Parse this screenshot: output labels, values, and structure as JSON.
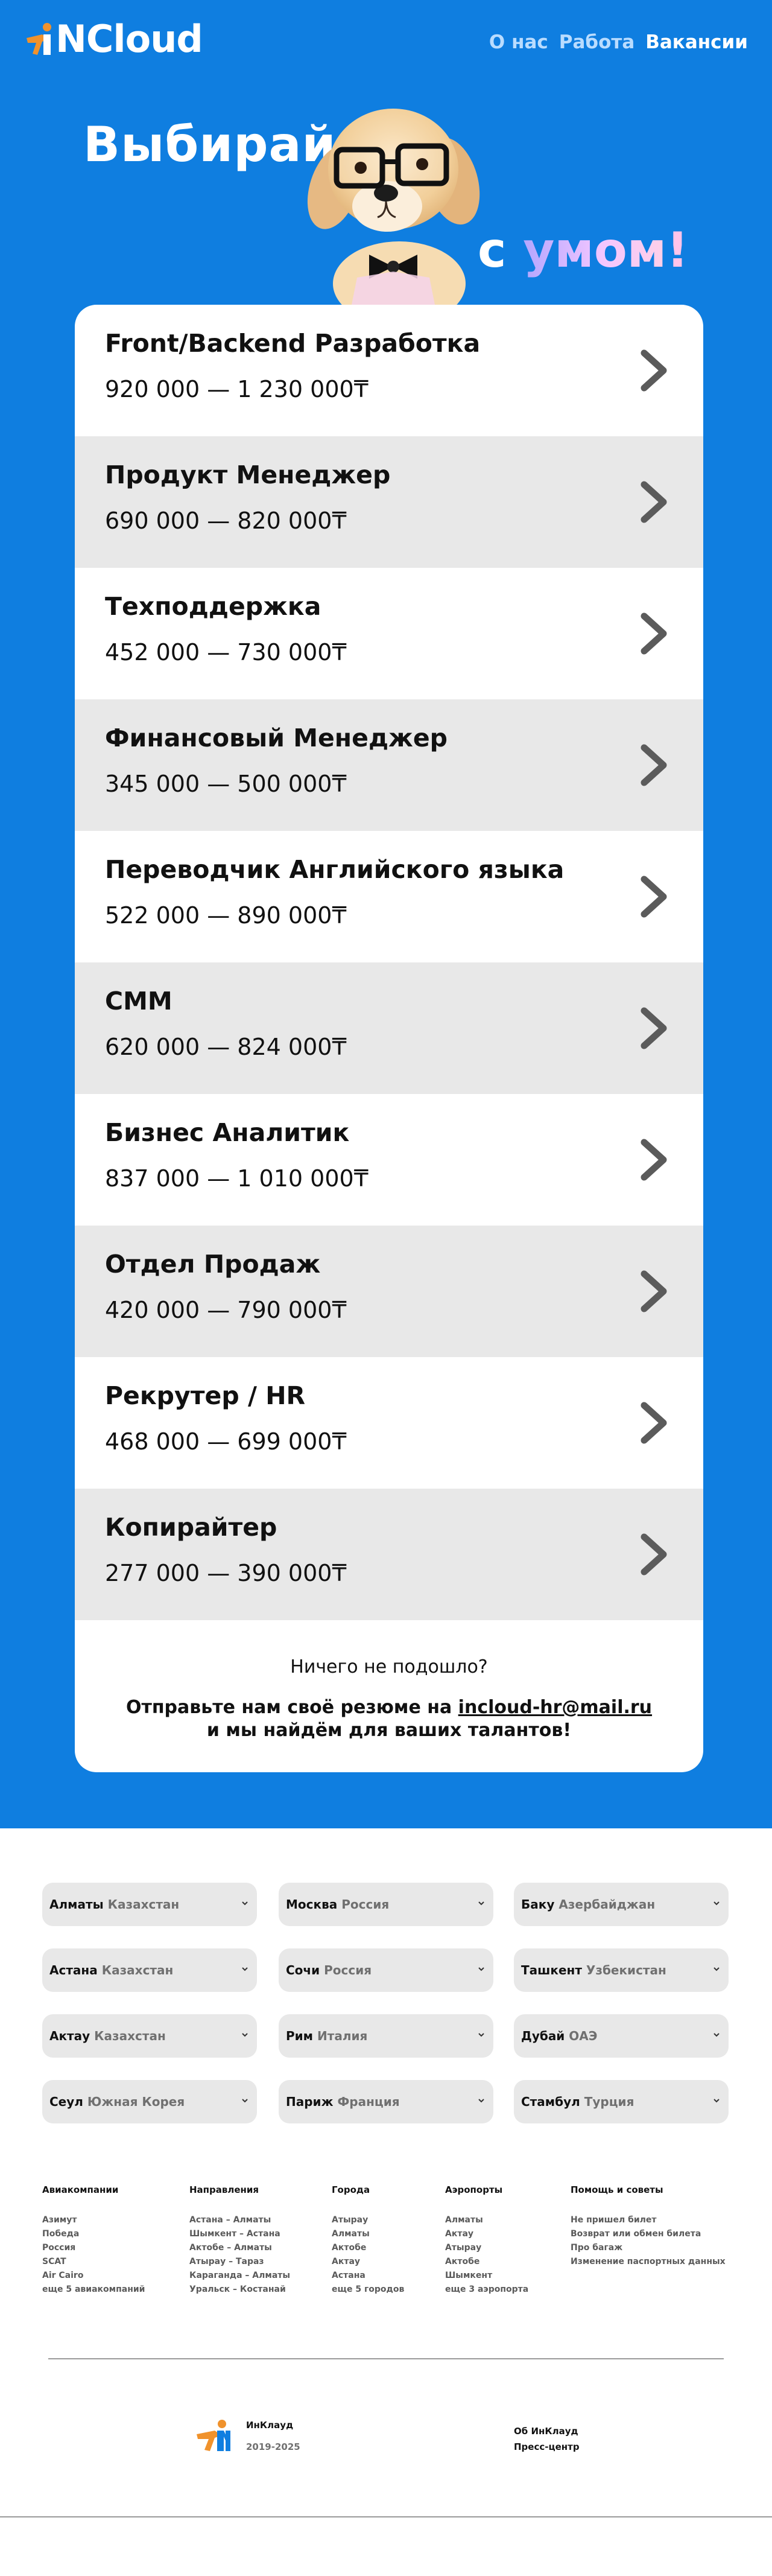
{
  "brand": {
    "logo_text": "NCloud"
  },
  "nav": {
    "about": "О нас",
    "work": "Работа",
    "vacancies": "Вакансии"
  },
  "hero": {
    "headline_line1": "Выбирай",
    "headline_c": "с ",
    "headline_smart": "умом",
    "headline_ex": "!"
  },
  "vacancies": [
    {
      "title": "Front/Backend Разработка",
      "salary": "920 000 — 1 230 000₸"
    },
    {
      "title": "Продукт Менеджер",
      "salary": "690 000 — 820 000₸"
    },
    {
      "title": "Техподдержка",
      "salary": "452 000 — 730 000₸"
    },
    {
      "title": "Финансовый Менеджер",
      "salary": "345 000 — 500 000₸"
    },
    {
      "title": "Переводчик Английского языка",
      "salary": "522 000 — 890 000₸"
    },
    {
      "title": "СММ",
      "salary": "620 000 — 824 000₸"
    },
    {
      "title": "Бизнес Аналитик",
      "salary": "837 000 — 1 010 000₸"
    },
    {
      "title": "Отдел Продаж",
      "salary": "420 000 — 790 000₸"
    },
    {
      "title": "Рекрутер / HR",
      "salary": "468 000 — 699 000₸"
    },
    {
      "title": "Копирайтер",
      "salary": "277 000 — 390 000₸"
    }
  ],
  "card_footer": {
    "nothing_fit": "Ничего не подошло?",
    "send_before": "Отправьте нам своё резюме на ",
    "email": "incloud-hr@mail.ru",
    "send_after": " и мы найдём для ваших талантов!"
  },
  "cities": [
    {
      "city": "Алматы",
      "country": "Казахстан"
    },
    {
      "city": "Москва",
      "country": "Россия"
    },
    {
      "city": "Баку",
      "country": "Азербайджан"
    },
    {
      "city": "Астана",
      "country": "Казахстан"
    },
    {
      "city": "Сочи",
      "country": "Россия"
    },
    {
      "city": "Ташкент",
      "country": "Узбекистан"
    },
    {
      "city": "Актау",
      "country": "Казахстан"
    },
    {
      "city": "Рим",
      "country": "Италия"
    },
    {
      "city": "Дубай",
      "country": "ОАЭ"
    },
    {
      "city": "Сеул",
      "country": "Южная Корея"
    },
    {
      "city": "Париж",
      "country": "Франция"
    },
    {
      "city": "Стамбул",
      "country": "Турция"
    }
  ],
  "footer": {
    "airlines": {
      "title": "Авиакомпании",
      "links": [
        "Азимут",
        "Победа",
        "Россия",
        "SCAT",
        "Air Cairo",
        "еще 5 авиакомпаний"
      ]
    },
    "directions": {
      "title": "Направления",
      "links": [
        "Астана – Алматы",
        "Шымкент – Астана",
        "Актобе – Алматы",
        "Атырау – Тараз",
        "Караганда – Алматы",
        "Уральск – Костанай"
      ]
    },
    "cities": {
      "title": "Города",
      "links": [
        "Атырау",
        "Алматы",
        "Актобе",
        "Актау",
        "Астана",
        "еще 5 городов"
      ]
    },
    "airports": {
      "title": "Аэропорты",
      "links": [
        "Алматы",
        "Актау",
        "Атырау",
        "Актобе",
        "Шымкент",
        "еще 3 аэропорта"
      ]
    },
    "help": {
      "title": "Помощь и советы",
      "links": [
        "Не пришел билет",
        "Возврат или обмен билета",
        "Про багаж",
        "Изменение паспортных данных"
      ]
    },
    "brand_name": "ИнКлауд",
    "years": "2019-2025",
    "about": "Об ИнКлауд",
    "press": "Пресс-центр"
  },
  "colors": {
    "primary": "#0f7ee0",
    "row_shade": "#e8e8e8",
    "logo_accent": "#f0922c"
  }
}
